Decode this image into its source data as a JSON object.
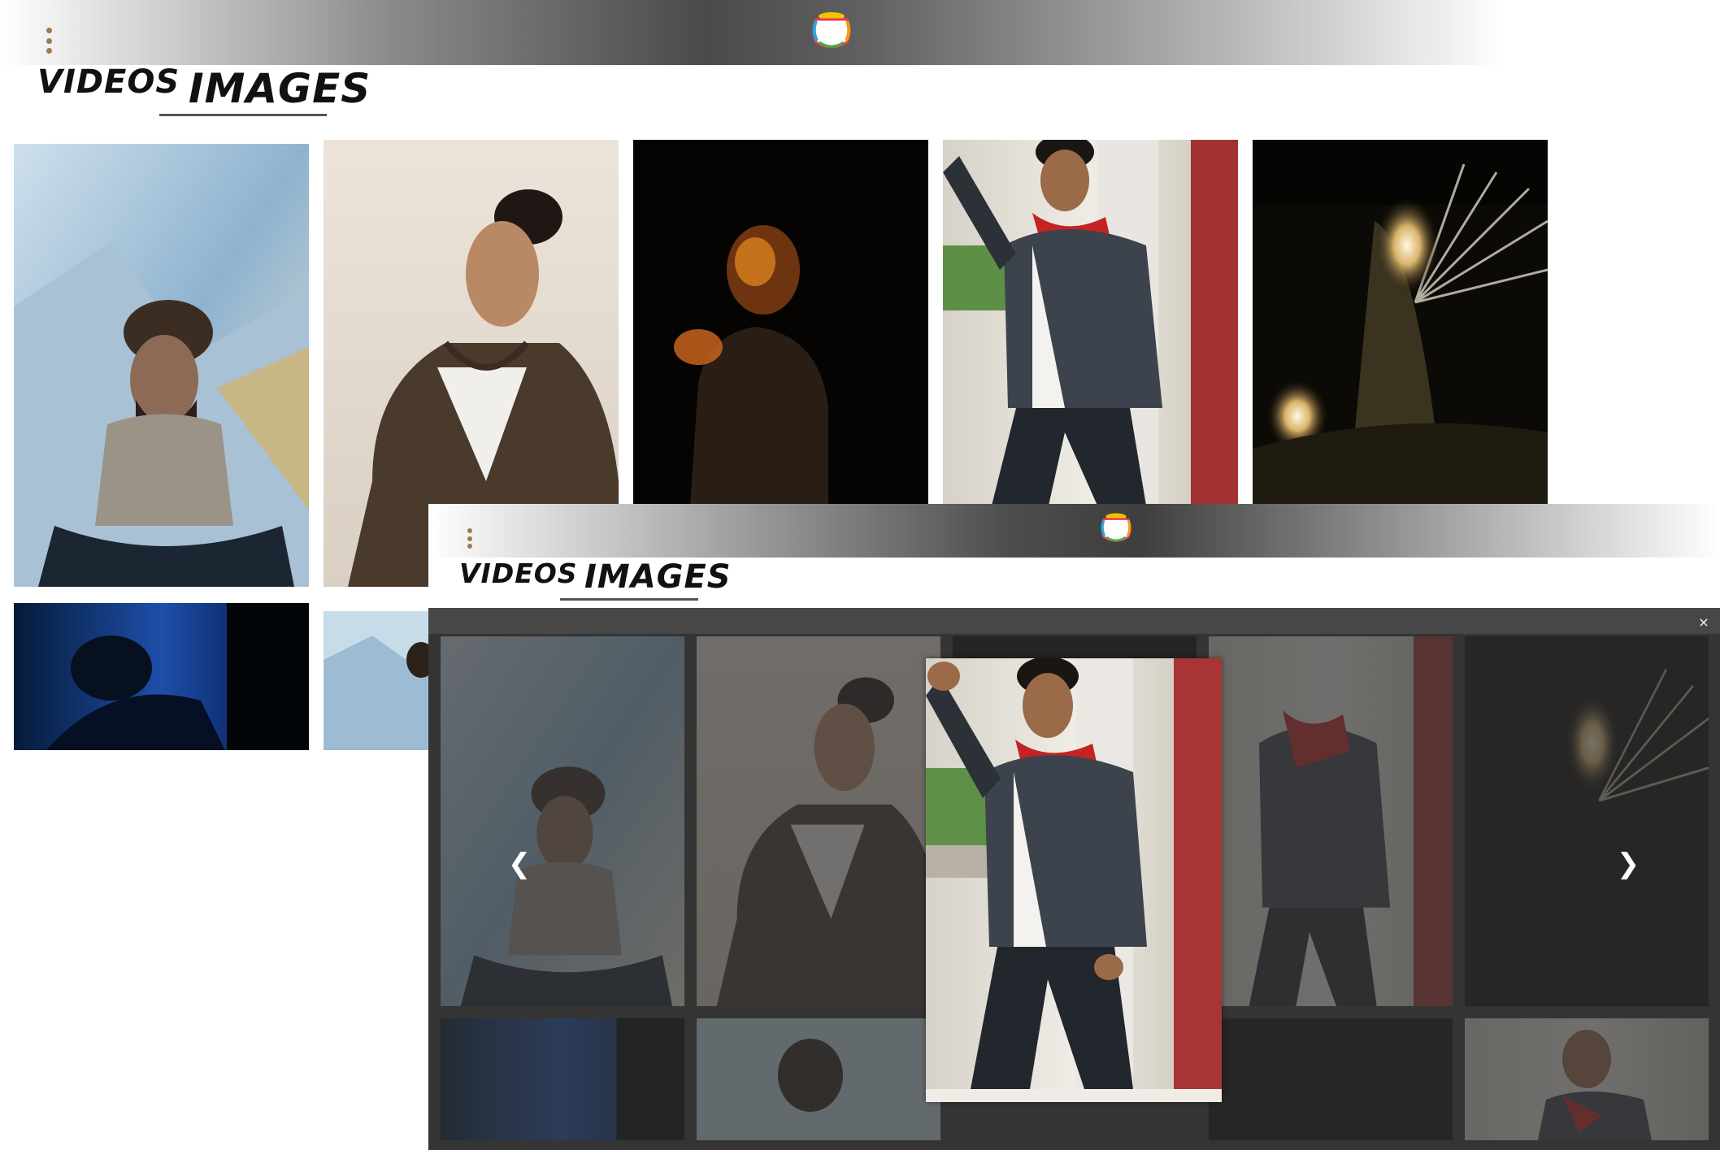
{
  "window_back": {
    "tabs": {
      "videos": "VIDEOS",
      "images": "IMAGES"
    },
    "active_tab": "images"
  },
  "window_front": {
    "tabs": {
      "videos": "VIDEOS",
      "images": "IMAGES"
    },
    "active_tab": "images",
    "lightbox": {
      "close_label": "×",
      "prev_label": "❮",
      "next_label": "❯"
    }
  },
  "gallery": [
    {
      "name": "seated-bearded-man-in-sweater"
    },
    {
      "name": "man-in-cap-and-jacket"
    },
    {
      "name": "blurred-figure-dark-background"
    },
    {
      "name": "man-in-leather-jacket-posing"
    },
    {
      "name": "fireworks-night-scene"
    },
    {
      "name": "dark-blue-silhouette"
    },
    {
      "name": "man-on-blue-sky-background"
    }
  ],
  "colors": {
    "menu_dots": "#9a7b52",
    "overlay": "#343434",
    "text": "#111111"
  }
}
